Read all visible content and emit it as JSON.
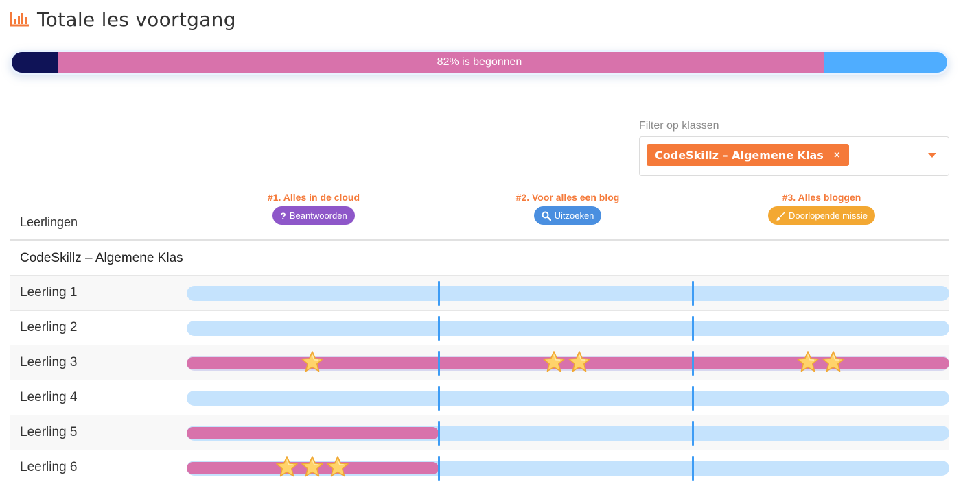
{
  "header": {
    "title": "Totale les voortgang",
    "icon": "bar-chart-icon"
  },
  "total_progress": {
    "label": "82% is begonnen",
    "done_fraction": 0.05,
    "started_fraction": 0.82,
    "colors": {
      "done": "#0f1357",
      "started": "#d872ab",
      "rest": "#4fadff"
    }
  },
  "filter": {
    "label": "Filter op klassen",
    "selected": "CodeSkillz – Algemene Klas",
    "remove_label": "×"
  },
  "table": {
    "students_header": "Leerlingen",
    "lessons": [
      {
        "title": "#1. Alles in de cloud",
        "badge": "Beantwoorden",
        "badge_icon": "question-icon",
        "badge_color": "#8e57c9"
      },
      {
        "title": "#2. Voor alles een blog",
        "badge": "Uitzoeken",
        "badge_icon": "search-icon",
        "badge_color": "#4a8fe0"
      },
      {
        "title": "#3. Alles bloggen",
        "badge": "Doorlopende missie",
        "badge_icon": "brush-icon",
        "badge_color": "#f3a832"
      }
    ],
    "class_name": "CodeSkillz – Algemene Klas",
    "students": [
      {
        "name": "Leerling 1",
        "progress": 0,
        "stars": [
          0,
          0,
          0
        ]
      },
      {
        "name": "Leerling 2",
        "progress": 0,
        "stars": [
          0,
          0,
          0
        ]
      },
      {
        "name": "Leerling 3",
        "progress": 1,
        "stars": [
          1,
          2,
          2
        ]
      },
      {
        "name": "Leerling 4",
        "progress": 0,
        "stars": [
          0,
          0,
          0
        ]
      },
      {
        "name": "Leerling 5",
        "progress": 0.33,
        "stars": [
          0,
          0,
          0
        ]
      },
      {
        "name": "Leerling 6",
        "progress": 0.33,
        "stars": [
          3,
          0,
          0
        ]
      }
    ]
  }
}
